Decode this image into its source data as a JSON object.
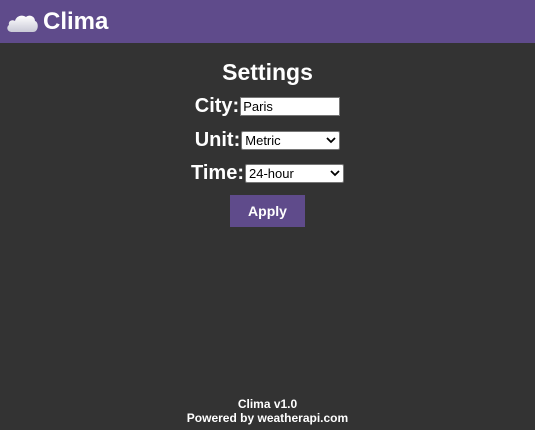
{
  "header": {
    "logo_icon": "cloud-icon",
    "title": "Clima"
  },
  "settings": {
    "title": "Settings",
    "city": {
      "label": "City:",
      "value": "Paris"
    },
    "unit": {
      "label": "Unit:",
      "selected": "Metric"
    },
    "time": {
      "label": "Time:",
      "selected": "24-hour"
    },
    "apply_label": "Apply"
  },
  "footer": {
    "version": "Clima v1.0",
    "powered_by": "Powered by weatherapi.com"
  },
  "colors": {
    "brand": "#5f4b8b",
    "background": "#333333",
    "text": "#ffffff"
  }
}
